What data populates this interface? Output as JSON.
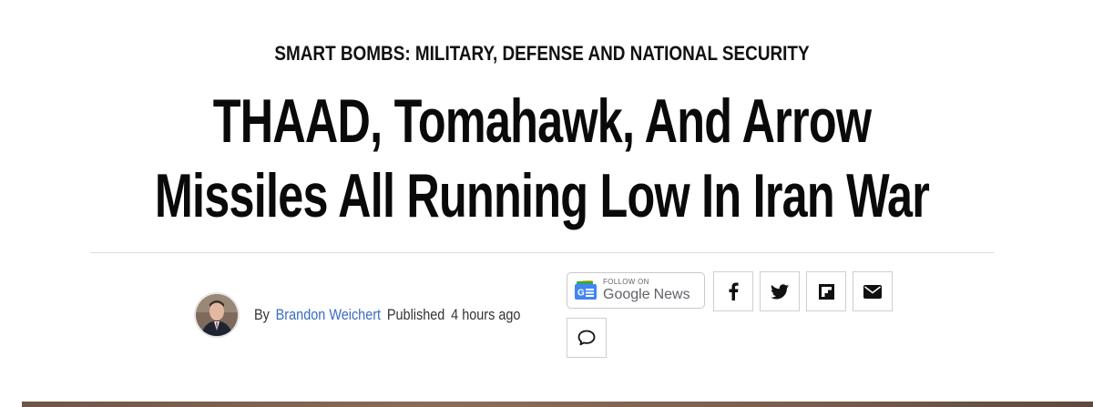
{
  "article": {
    "category": "SMART BOMBS: MILITARY, DEFENSE AND NATIONAL SECURITY",
    "headline_line1": "THAAD, Tomahawk, And Arrow",
    "headline_line2": "Missiles All Running Low In Iran War"
  },
  "byline": {
    "by_label": "By",
    "author": "Brandon Weichert",
    "published_label": "Published",
    "time_ago": "4 hours ago"
  },
  "share": {
    "google_news": {
      "follow_label": "FOLLOW ON",
      "brand_google": "Google",
      "brand_news": "News",
      "icon": "google-news-icon"
    },
    "buttons": [
      {
        "icon": "facebook-icon"
      },
      {
        "icon": "twitter-icon"
      },
      {
        "icon": "flipboard-icon"
      },
      {
        "icon": "email-icon"
      },
      {
        "icon": "comment-icon"
      }
    ]
  },
  "colors": {
    "author_link": "#3a6bc4",
    "text": "#111111",
    "divider": "#dcdcdc"
  }
}
